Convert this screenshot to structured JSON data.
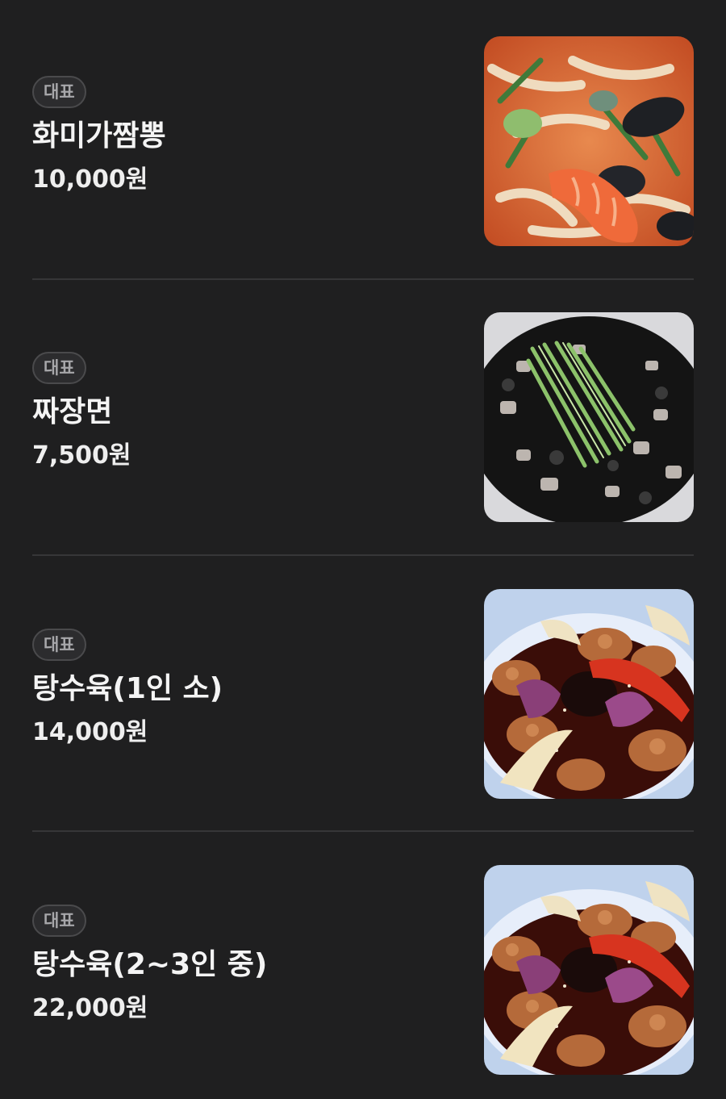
{
  "menu": {
    "items": [
      {
        "badge": "대표",
        "name": "화미가짬뽕",
        "price": "10,000원",
        "image": "jjamppong-photo"
      },
      {
        "badge": "대표",
        "name": "짜장면",
        "price": "7,500원",
        "image": "jajangmyeon-photo"
      },
      {
        "badge": "대표",
        "name": "탕수육(1인 소)",
        "price": "14,000원",
        "image": "tangsuyuk-photo"
      },
      {
        "badge": "대표",
        "name": "탕수육(2~3인 중)",
        "price": "22,000원",
        "image": "tangsuyuk-photo"
      }
    ]
  },
  "colors": {
    "background": "#1f1f20",
    "divider": "#363638",
    "badge_border": "#4a4a4c",
    "badge_text": "#a7a7aa",
    "text": "#f4f4f4"
  }
}
